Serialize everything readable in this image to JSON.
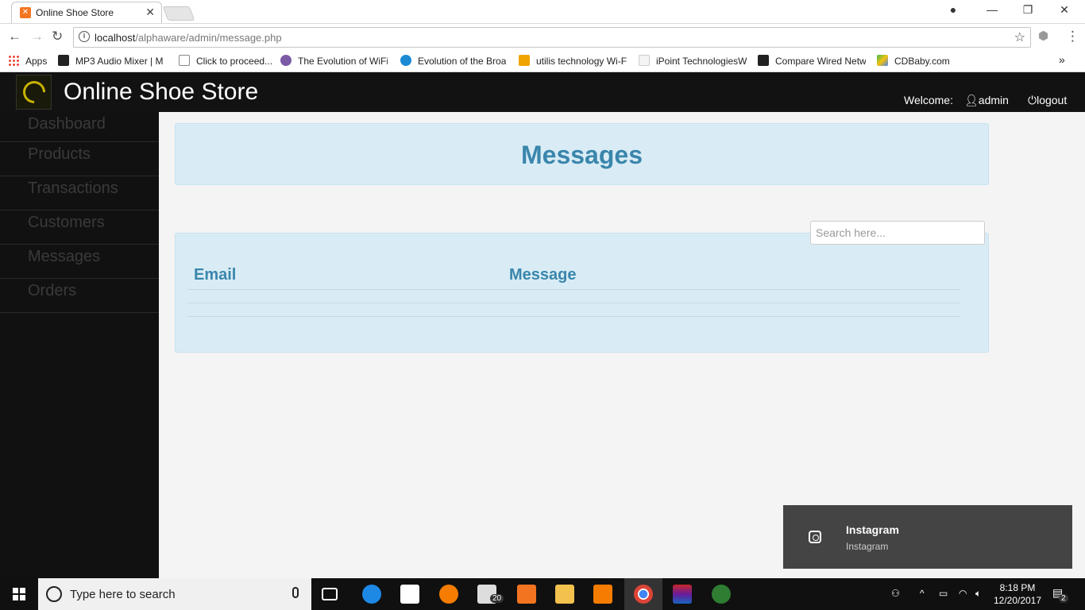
{
  "browser": {
    "tab_title": "Online Shoe Store",
    "url_host": "localhost",
    "url_path": "/alphaware/admin/message.php",
    "bookmarks": [
      {
        "label": "Apps"
      },
      {
        "label": "MP3 Audio Mixer | M"
      },
      {
        "label": "Click to proceed..."
      },
      {
        "label": "The Evolution of WiFi"
      },
      {
        "label": "Evolution of the Broa"
      },
      {
        "label": "utilis technology Wi-F"
      },
      {
        "label": "iPoint TechnologiesW"
      },
      {
        "label": "Compare Wired Netw"
      },
      {
        "label": "CDBaby.com"
      }
    ],
    "more_bookmarks": "»"
  },
  "header": {
    "brand": "Online Shoe Store",
    "welcome": "Welcome:",
    "user": "admin",
    "logout": "logout"
  },
  "sidebar": {
    "items": [
      {
        "label": "Dashboard"
      },
      {
        "label": "Products"
      },
      {
        "label": "Transactions"
      },
      {
        "label": "Customers"
      },
      {
        "label": "Messages"
      },
      {
        "label": "Orders"
      }
    ]
  },
  "main": {
    "title": "Messages",
    "search_placeholder": "Search here...",
    "table": {
      "columns": [
        "Email",
        "Message"
      ],
      "rows": []
    }
  },
  "toast": {
    "title": "Instagram",
    "subtitle": "Instagram"
  },
  "taskbar": {
    "search_placeholder": "Type here to search",
    "mail_badge": "20",
    "time": "8:18 PM",
    "date": "12/20/2017",
    "notification_count": "2"
  },
  "colors": {
    "accent": "#3a86ac",
    "panel_bg": "#d9ecf5",
    "header_bg": "#121212",
    "sidebar_bg": "#111111"
  }
}
